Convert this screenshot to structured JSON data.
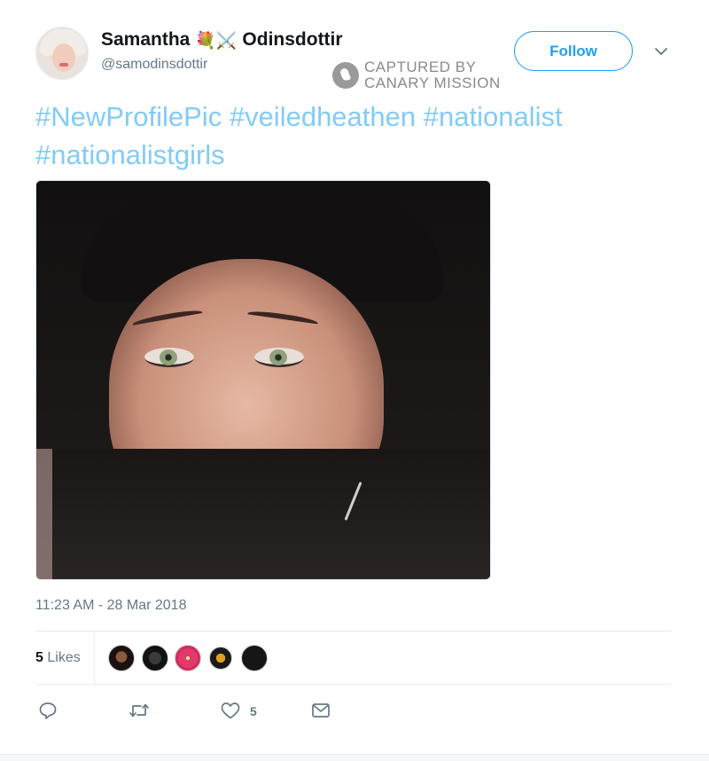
{
  "user": {
    "display_name_first": "Samantha",
    "display_name_last": "Odinsdottir",
    "emoji_1": "💐",
    "emoji_2": "⚔️",
    "handle": "@samodinsdottir",
    "avatar_icon": "user-avatar"
  },
  "watermark": {
    "line1": "CAPTURED BY",
    "line2": "CANARY MISSION",
    "logo_icon": "canary-logo-icon"
  },
  "header": {
    "follow_label": "Follow",
    "menu_icon": "chevron-down-icon"
  },
  "tweet": {
    "hashtags": [
      "#NewProfilePic",
      "#veiledheathen",
      "#nationalist",
      "#nationalistgirls"
    ],
    "timestamp": "11:23 AM - 28 Mar 2018"
  },
  "stats": {
    "likes_count": "5",
    "likes_label": "Likes"
  },
  "actions": {
    "reply_icon": "reply-icon",
    "retweet_icon": "retweet-icon",
    "like_icon": "heart-icon",
    "like_count": "5",
    "dm_icon": "envelope-icon"
  },
  "colors": {
    "accent": "#1da1f2",
    "muted": "#657786",
    "text": "#14171a",
    "border": "#e6ecf0"
  }
}
